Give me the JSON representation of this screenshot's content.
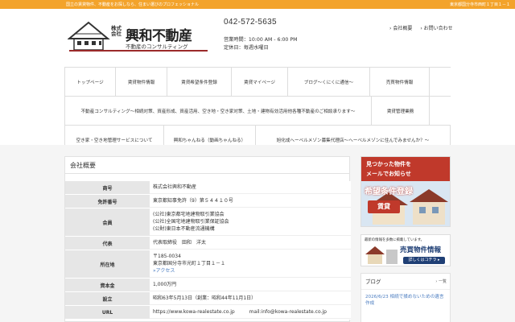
{
  "topbar": {
    "tagline": "国立の賃貸物件、不動産をお探しなら、住まい選びのプロフェッショナル",
    "address": "東京都国分寺市西町１丁目１－１"
  },
  "header": {
    "logo_company_prefix": "株式会社",
    "logo_name": "興和不動産",
    "logo_sub": "不動産のコンサルティング",
    "phone": "042-572-5635",
    "hours": "営業時間：10:00 AM - 6:00 PM",
    "closed": "定休日：毎週水曜日",
    "links": [
      {
        "label": "会社概要"
      },
      {
        "label": "お問い合わせ"
      }
    ]
  },
  "nav": {
    "row1": [
      "トップページ",
      "賃貸物件情報",
      "賃貸希望条件登録",
      "賃貸マイページ",
      "ブログ～くにくに通信～",
      "売買物件情報"
    ],
    "row2": [
      "不動産コンサルティング～相続対策、資産形成、資産活用、空き地・空き家対策、土地・建物有効活用他各種不動産のご相談承ります～",
      "賃貸管理業務"
    ],
    "row3": [
      "空き家・空き地管理サービスについて",
      "興和ちゃんねる（動画ちゃんねる）",
      "旭化成ヘーベルメゾン募集代理店～ヘーベルメゾンに住んでみませんか？～"
    ]
  },
  "main": {
    "title": "会社概要",
    "rows": [
      {
        "label": "商号",
        "lines": [
          "株式会社興和不動産"
        ]
      },
      {
        "label": "免許番号",
        "lines": [
          "東京都知事免許（9）第５４４１０号"
        ]
      },
      {
        "label": "会員",
        "lines": [
          "(公社)東京都宅地建物取引業協会",
          "(公社)全国宅地建物取引業保証協会",
          "(公財)東日本不動産流通機構"
        ]
      },
      {
        "label": "代表",
        "lines": [
          "代表取締役　田和　洋太"
        ]
      },
      {
        "label": "所在地",
        "lines": [
          "〒185-0034",
          "東京都国分寺市光町１丁目１－１"
        ],
        "link": "»アクセス"
      },
      {
        "label": "資本金",
        "lines": [
          "1,000万円"
        ]
      },
      {
        "label": "設立",
        "lines": [
          "昭和63年5月13日（創業：昭和44年11月1日）"
        ]
      },
      {
        "label": "URL",
        "lines": [
          "https://www.kowa-realestate.co.jp　　　mail:info@kowa-realestate.co.jp"
        ]
      }
    ]
  },
  "sidebar": {
    "banner1": {
      "line1": "見つかった物件を",
      "line2": "メールでお知らせ",
      "label": "希望条件登録",
      "badge": "賃貸"
    },
    "banner2": {
      "top": "最新の情報を多数に掲載しています。",
      "title": "売買物件情報",
      "btn": "詳しくはコチラ ▸"
    },
    "blog": {
      "title": "ブログ",
      "more": "一覧",
      "entry_date": "2026/6/23",
      "entry_title": "相続で揉めないための遺言作成"
    }
  },
  "colors": {
    "accent": "#f3a32b",
    "brand_red": "#9b2a2a",
    "link": "#4a7cc0"
  }
}
